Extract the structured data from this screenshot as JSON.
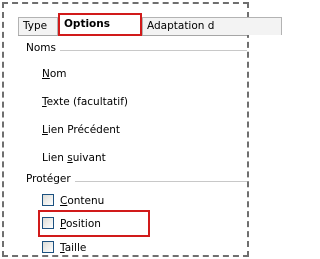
{
  "tabs": [
    {
      "label": "Type"
    },
    {
      "label": "Options",
      "active": true
    },
    {
      "label": "Adaptation d"
    }
  ],
  "groups": {
    "noms": {
      "label": "Noms",
      "items": [
        {
          "before": "",
          "mnemonic": "N",
          "after": "om"
        },
        {
          "before": "",
          "mnemonic": "T",
          "after": "exte (facultatif)"
        },
        {
          "before": "",
          "mnemonic": "L",
          "after": "ien Précédent"
        },
        {
          "before": "Lien ",
          "mnemonic": "s",
          "after": "uivant"
        }
      ]
    },
    "proteger": {
      "label": "Protéger",
      "checkboxes": [
        {
          "before": "",
          "mnemonic": "C",
          "after": "ontenu",
          "checked": false
        },
        {
          "before": "",
          "mnemonic": "P",
          "after": "osition",
          "checked": false,
          "highlighted": true
        },
        {
          "before": "",
          "mnemonic": "T",
          "after": "aille",
          "checked": false
        }
      ]
    }
  },
  "colors": {
    "highlight": "#d11a1a",
    "checkbox_border": "#1c5180"
  }
}
